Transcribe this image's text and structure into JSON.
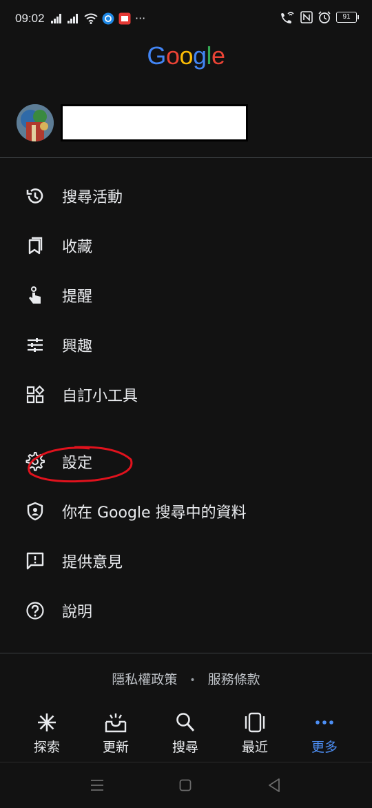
{
  "status_bar": {
    "time": "09:02",
    "battery": "91"
  },
  "header": {
    "logo_text": "Google"
  },
  "colors": {
    "accent": "#4d8ff5",
    "g_blue": "#4285F4",
    "g_red": "#EA4335",
    "g_yellow": "#FBBC05",
    "g_green": "#34A853",
    "annotation": "#e0121d"
  },
  "menu": {
    "group1": [
      {
        "label": "搜尋活動",
        "icon": "history-icon"
      },
      {
        "label": "收藏",
        "icon": "bookmarks-icon"
      },
      {
        "label": "提醒",
        "icon": "reminder-icon"
      },
      {
        "label": "興趣",
        "icon": "tune-icon"
      },
      {
        "label": "自訂小工具",
        "icon": "widgets-icon"
      }
    ],
    "group2": [
      {
        "label": "設定",
        "icon": "gear-icon"
      },
      {
        "label": "你在 Google 搜尋中的資料",
        "icon": "privacy-shield-icon"
      },
      {
        "label": "提供意見",
        "icon": "feedback-icon"
      },
      {
        "label": "說明",
        "icon": "help-icon"
      }
    ]
  },
  "footer": {
    "privacy": "隱私權政策",
    "separator": "•",
    "terms": "服務條款"
  },
  "bottom_nav": [
    {
      "label": "探索",
      "icon": "discover-icon"
    },
    {
      "label": "更新",
      "icon": "updates-icon"
    },
    {
      "label": "搜尋",
      "icon": "search-icon"
    },
    {
      "label": "最近",
      "icon": "recents-icon"
    },
    {
      "label": "更多",
      "icon": "more-icon",
      "active": true
    }
  ]
}
